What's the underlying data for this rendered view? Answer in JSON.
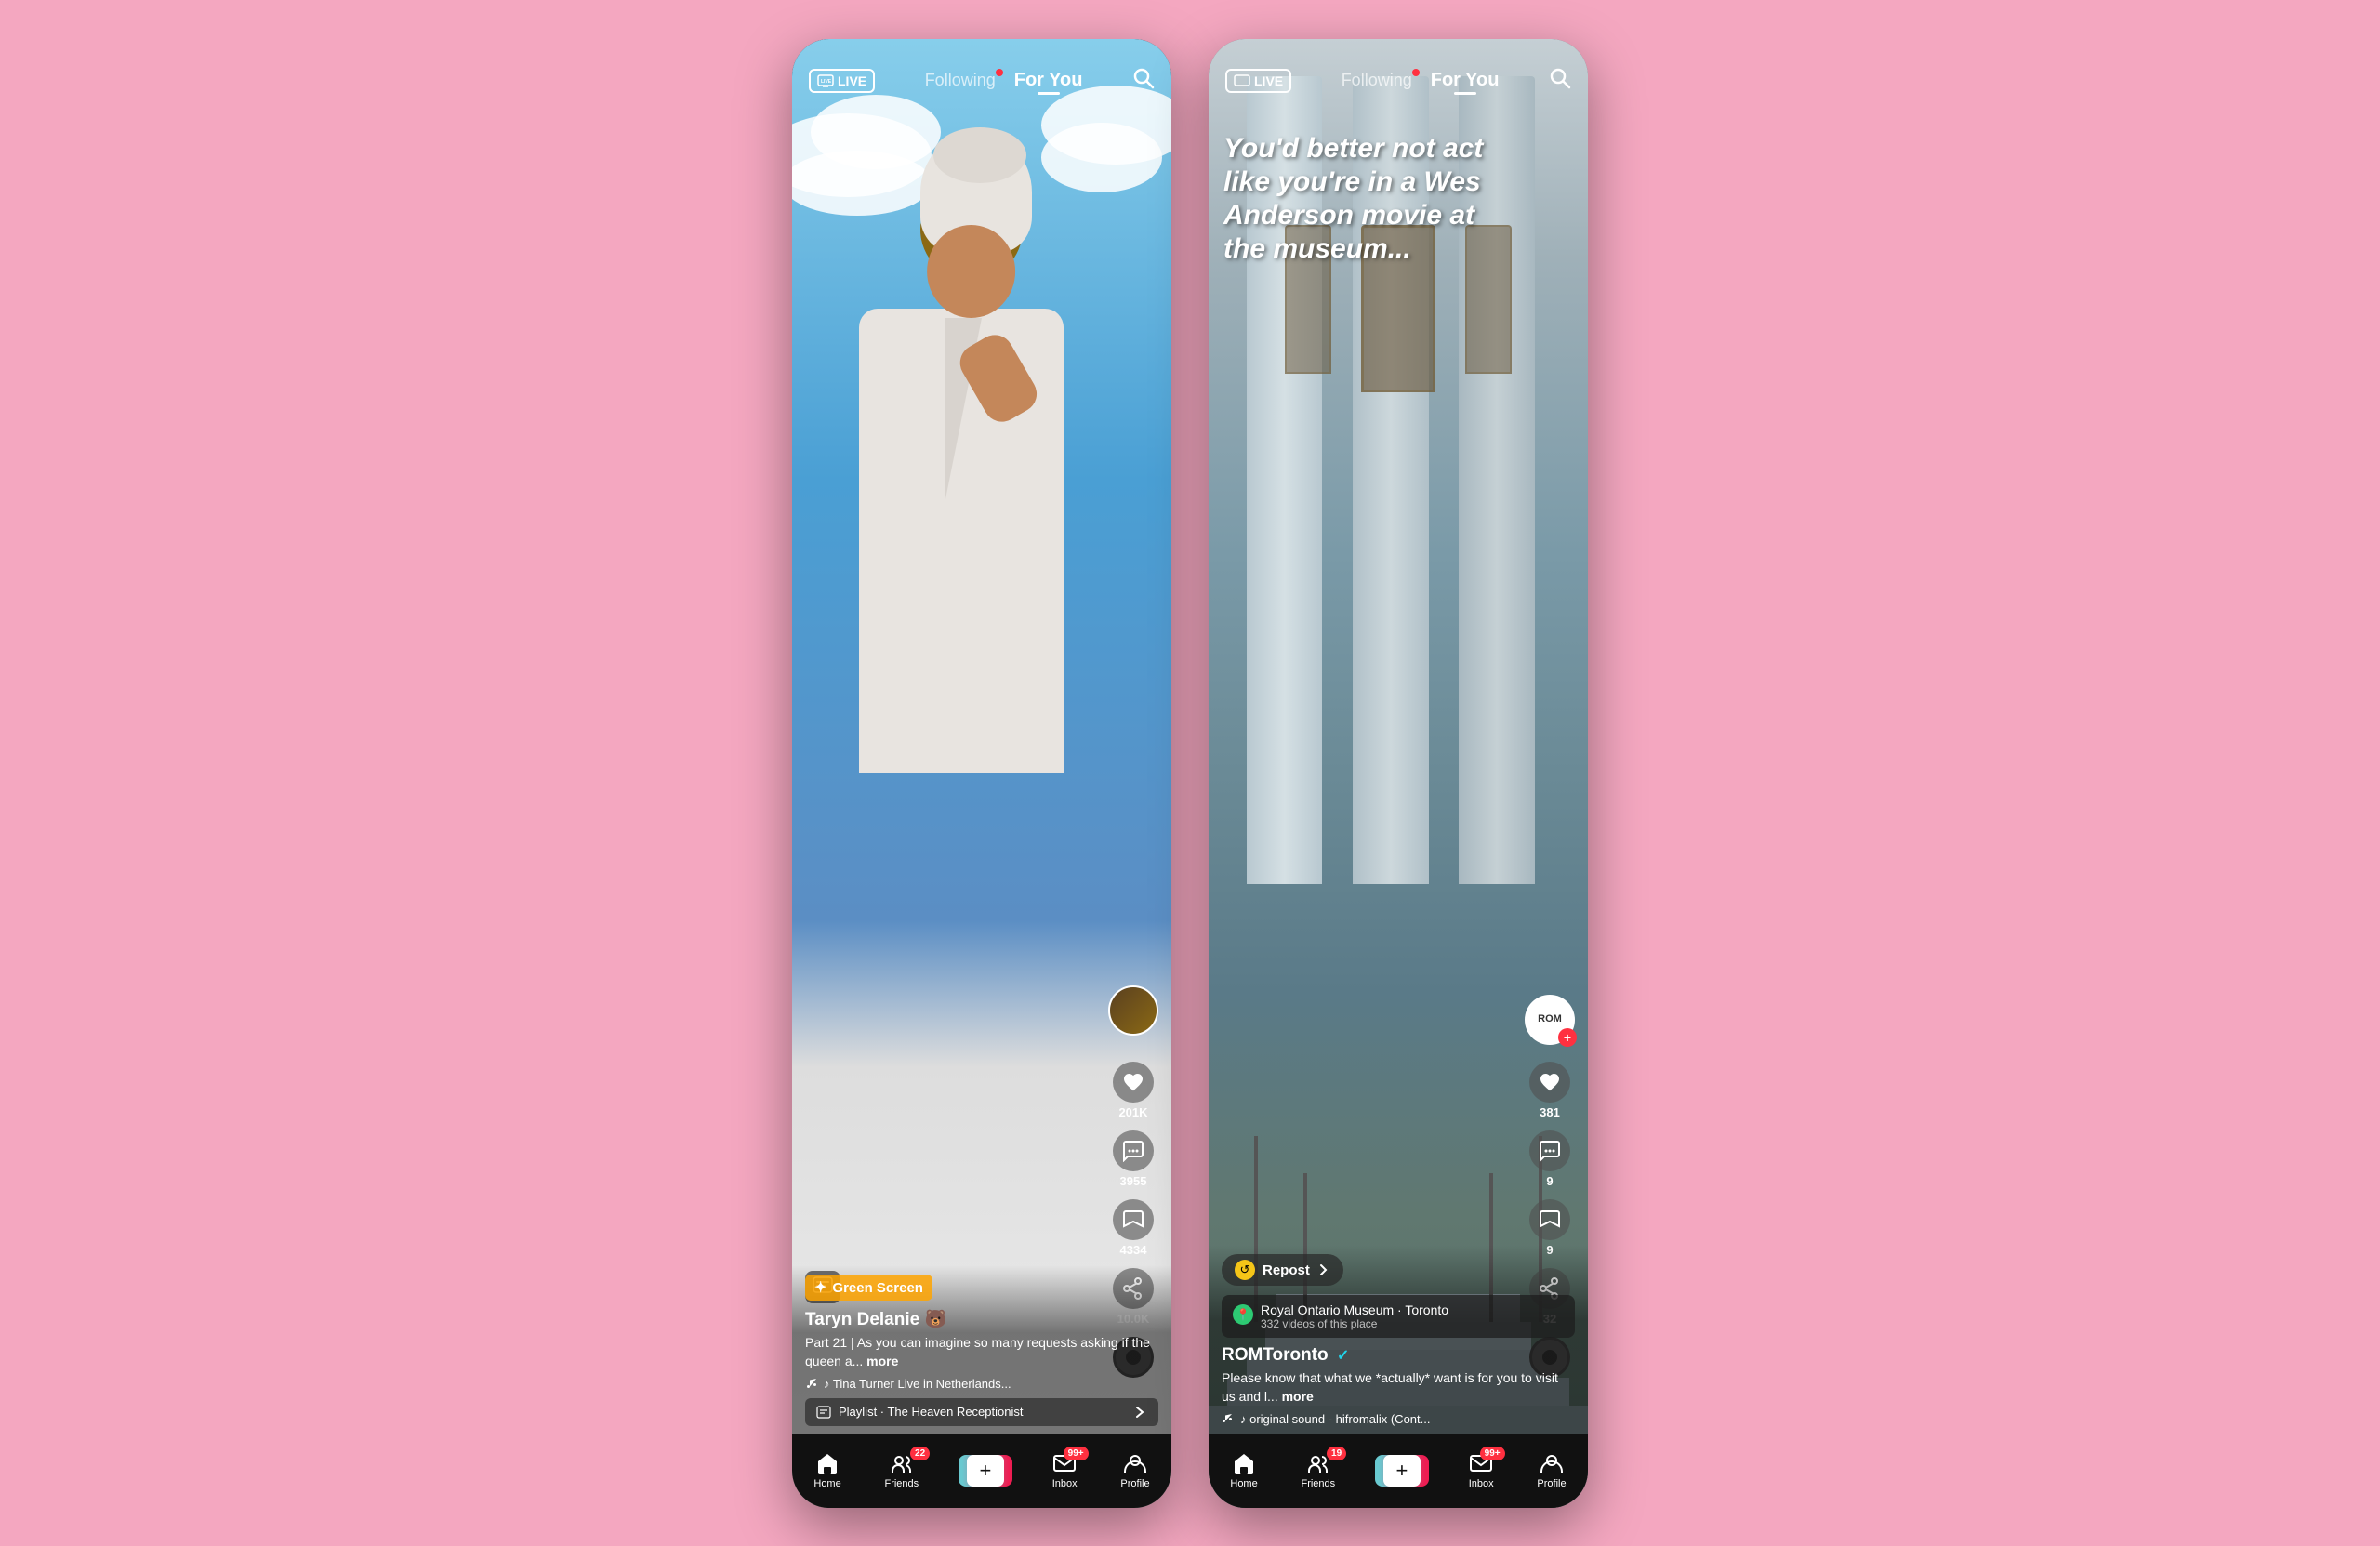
{
  "app": {
    "background_color": "#f4a7c0"
  },
  "phone1": {
    "header": {
      "live_label": "LIVE",
      "following_label": "Following",
      "foryou_label": "For You",
      "active_tab": "foryou"
    },
    "video": {
      "tag_label": "Green Screen",
      "username": "Taryn Delanie 🐻",
      "caption": "Part 21 | As you can imagine so many requests asking if the queen a...",
      "more_label": "more",
      "sound": "♪ Tina Turner Live in Netherlands...",
      "playlist_label": "Playlist · The Heaven Receptionist"
    },
    "actions": {
      "likes": "201K",
      "comments": "3955",
      "bookmarks": "4334",
      "shares": "10.0K"
    },
    "nav": {
      "home_label": "Home",
      "friends_label": "Friends",
      "friends_badge": "22",
      "inbox_label": "Inbox",
      "inbox_badge": "99+",
      "profile_label": "Profile"
    }
  },
  "phone2": {
    "header": {
      "live_label": "LIVE",
      "following_label": "Following",
      "foryou_label": "For You",
      "active_tab": "foryou"
    },
    "video": {
      "overlay_text": "You'd better not act like you're in a Wes Anderson movie at the museum...",
      "avatar_text": "ROM",
      "repost_label": "Repost",
      "location_name": "Royal Ontario Museum · Toronto",
      "location_sub": "332 videos of this place",
      "username": "ROMToronto",
      "verified": true,
      "caption": "Please know that what we *actually* want is for you to visit us and l...",
      "more_label": "more",
      "sound": "♪ original sound - hifromalix (Cont..."
    },
    "actions": {
      "likes": "381",
      "comments": "9",
      "bookmarks": "9",
      "shares": "32"
    },
    "nav": {
      "home_label": "Home",
      "friends_label": "Friends",
      "friends_badge": "19",
      "inbox_label": "Inbox",
      "inbox_badge": "99+",
      "profile_label": "Profile"
    }
  }
}
